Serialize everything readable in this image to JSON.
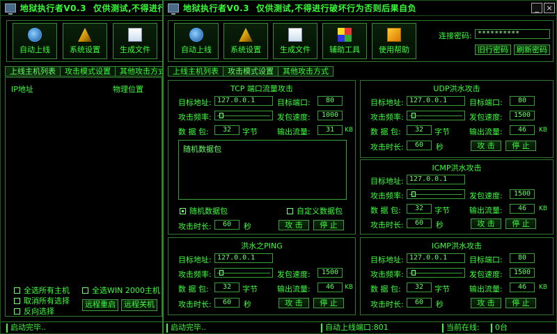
{
  "window_back": {
    "title": "地狱执行者V0.3",
    "warning": "仅供测试,不得进行",
    "toolbar": [
      {
        "label": "自动上线",
        "icon": "refresh-icon"
      },
      {
        "label": "系统设置",
        "icon": "settings-icon"
      },
      {
        "label": "生成文件",
        "icon": "file-icon"
      }
    ],
    "tabs": [
      "上线主机列表",
      "攻击模式设置",
      "其他攻击方式"
    ],
    "list_headers": [
      "IP地址",
      "物理位置"
    ],
    "checkboxes": [
      "全选所有主机",
      "全选WIN 2000主机",
      "取消所有选择",
      "反向选择"
    ],
    "buttons": [
      "远程重启",
      "远程关机"
    ],
    "status": "启动完毕.."
  },
  "window_front": {
    "title": "地狱执行者V0.3",
    "warning": "仅供测试,不得进行破坏行为否则后果自负",
    "controls": {
      "minimize": "_",
      "close": "×"
    },
    "toolbar": [
      {
        "label": "自动上线",
        "icon": "refresh-icon"
      },
      {
        "label": "系统设置",
        "icon": "settings-icon"
      },
      {
        "label": "生成文件",
        "icon": "file-icon"
      },
      {
        "label": "辅助工具",
        "icon": "tools-icon"
      },
      {
        "label": "使用帮助",
        "icon": "help-icon"
      }
    ],
    "password": {
      "label": "连接密码:",
      "value": "**********",
      "btn1": "旧行密码",
      "btn2": "刷新密码"
    },
    "tabs": [
      "上线主机列表",
      "攻击模式设置",
      "其他攻击方式"
    ],
    "tcp": {
      "title": "TCP 端口流量攻击",
      "target_label": "目标地址:",
      "target": "127.0.0.1",
      "port_label": "目标端口:",
      "port": "80",
      "rate_label": "攻击频率:",
      "speed_label": "发包速度:",
      "speed": "1000",
      "packet_label": "数 据 包:",
      "packet": "32",
      "packet_unit": "字节",
      "output_label": "输出流量:",
      "output": "31",
      "output_unit": "KB",
      "packet_text": "随机数据包",
      "random_label": "随机数据包",
      "custom_label": "自定义数据包",
      "duration_label": "攻击时长:",
      "duration": "60",
      "duration_unit": "秒",
      "attack": "攻 击",
      "stop": "停 止"
    },
    "ping": {
      "title": "洪水之PING",
      "target_label": "目标地址:",
      "target": "127.0.0.1",
      "rate_label": "攻击频率:",
      "speed_label": "发包速度:",
      "speed": "1500",
      "packet_label": "数 据 包:",
      "packet": "32",
      "packet_unit": "字节",
      "output_label": "输出流量:",
      "output": "46",
      "output_unit": "KB",
      "duration_label": "攻击时长:",
      "duration": "60",
      "duration_unit": "秒",
      "attack": "攻 击",
      "stop": "停 止"
    },
    "udp": {
      "title": "UDP洪水攻击",
      "target_label": "目标地址:",
      "target": "127.0.0.1",
      "port_label": "目标端口:",
      "port": "80",
      "rate_label": "攻击频率:",
      "speed_label": "发包速度:",
      "speed": "1500",
      "packet_label": "数 据 包:",
      "packet": "32",
      "packet_unit": "字节",
      "output_label": "输出流量:",
      "output": "46",
      "output_unit": "KB",
      "duration_label": "攻击时长:",
      "duration": "60",
      "duration_unit": "秒",
      "attack": "攻 击",
      "stop": "停 止"
    },
    "icmp": {
      "title": "ICMP洪水攻击",
      "target_label": "目标地址:",
      "target": "127.0.0.1",
      "rate_label": "攻击频率:",
      "speed_label": "发包速度:",
      "speed": "1500",
      "packet_label": "数 据 包:",
      "packet": "32",
      "packet_unit": "字节",
      "output_label": "输出流量:",
      "output": "46",
      "output_unit": "KB",
      "duration_label": "攻击时长:",
      "duration": "60",
      "duration_unit": "秒",
      "attack": "攻 击",
      "stop": "停 止"
    },
    "igmp": {
      "title": "IGMP洪水攻击",
      "target_label": "目标地址:",
      "target": "127.0.0.1",
      "port_label": "目标端口:",
      "port": "80",
      "rate_label": "攻击频率:",
      "speed_label": "发包速度:",
      "speed": "1500",
      "packet_label": "数 据 包:",
      "packet": "32",
      "packet_unit": "字节",
      "output_label": "输出流量:",
      "output": "46",
      "output_unit": "KB",
      "duration_label": "攻击时长:",
      "duration": "60",
      "duration_unit": "秒",
      "attack": "攻 击",
      "stop": "停 止"
    },
    "status": {
      "left": "启动完毕..",
      "middle": "自动上线端口:801",
      "online_label": "当前在线:",
      "online_value": "0台"
    }
  },
  "colors": {
    "text": "#3aff3a",
    "border": "#2f7a2f",
    "background": "#000000"
  }
}
